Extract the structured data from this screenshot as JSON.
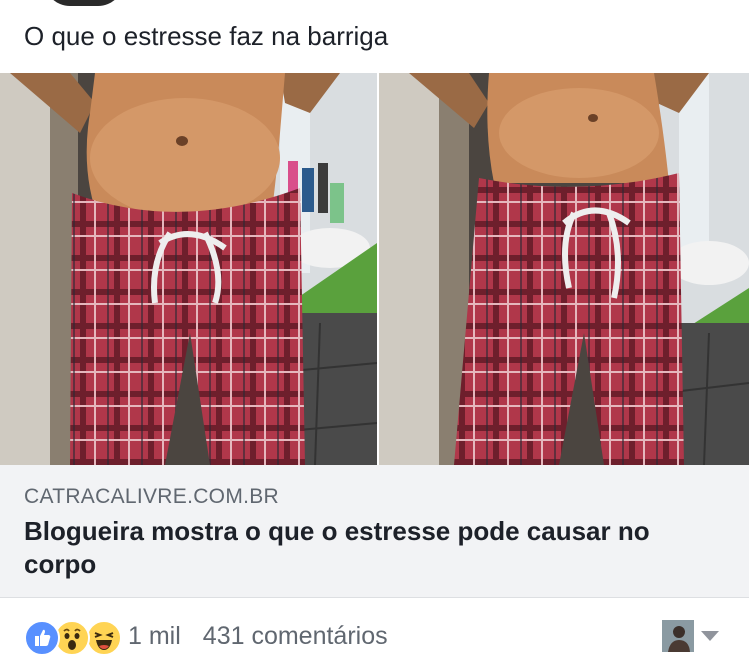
{
  "post": {
    "text": "O que o estresse faz na barriga"
  },
  "media": {
    "left_photo_icon": "before-photo-image",
    "right_photo_icon": "after-photo-image"
  },
  "link": {
    "domain": "CATRACALIVRE.COM.BR",
    "title": "Blogueira mostra o que o estresse pode causar no corpo"
  },
  "footer": {
    "reaction_icons": [
      "like-icon",
      "wow-icon",
      "haha-icon"
    ],
    "reactions_count": "1 mil",
    "comments_count": "431 comentários"
  },
  "colors": {
    "like_blue": "#5890ff",
    "emoji_yellow": "#ffd454",
    "muted_text": "#606770",
    "link_bg": "#f2f3f5"
  }
}
